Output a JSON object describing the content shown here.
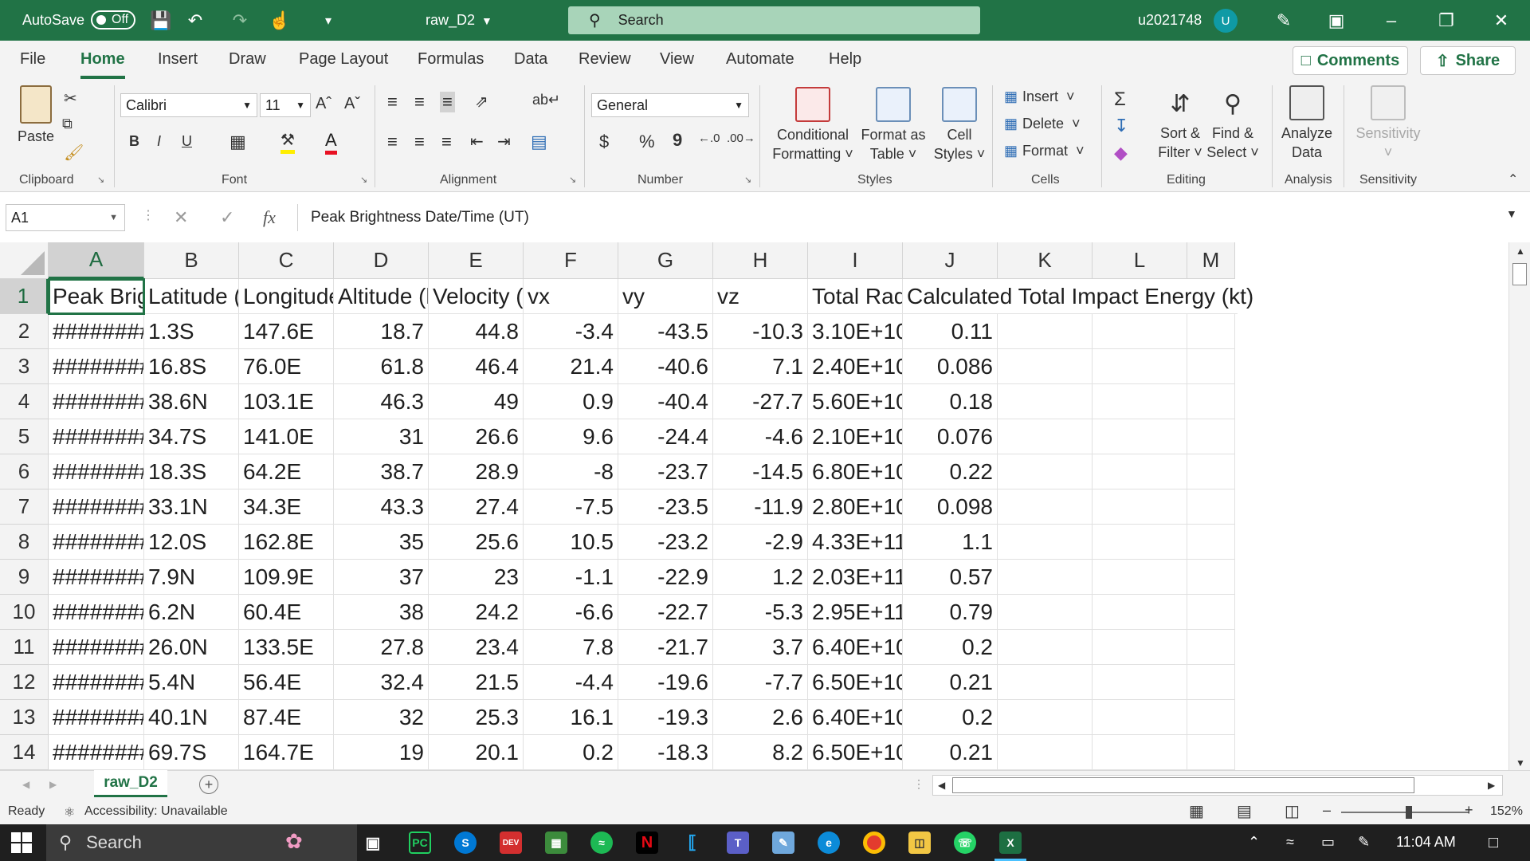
{
  "titlebar": {
    "autosave_label": "AutoSave",
    "autosave_state": "Off",
    "filename": "raw_D2",
    "search_placeholder": "Search",
    "user": "u2021748",
    "avatar_initial": "U"
  },
  "tabs": [
    "File",
    "Home",
    "Insert",
    "Draw",
    "Page Layout",
    "Formulas",
    "Data",
    "Review",
    "View",
    "Automate",
    "Help"
  ],
  "active_tab": "Home",
  "tab_actions": {
    "comments": "Comments",
    "share": "Share"
  },
  "ribbon": {
    "clipboard": {
      "paste": "Paste",
      "label": "Clipboard"
    },
    "font": {
      "name": "Calibri",
      "size": "11",
      "bold": "B",
      "italic": "I",
      "underline": "U",
      "label": "Font"
    },
    "alignment": {
      "label": "Alignment"
    },
    "number": {
      "format": "General",
      "label": "Number",
      "currency": "$",
      "percent": "%",
      "comma": "9"
    },
    "styles": {
      "conditional_line1": "Conditional",
      "conditional_line2": "Formatting",
      "format_table_line1": "Format as",
      "format_table_line2": "Table",
      "cell_styles_line1": "Cell",
      "cell_styles_line2": "Styles",
      "label": "Styles"
    },
    "cells": {
      "insert": "Insert",
      "delete": "Delete",
      "format": "Format",
      "label": "Cells"
    },
    "editing": {
      "sort_line1": "Sort &",
      "sort_line2": "Filter",
      "find_line1": "Find &",
      "find_line2": "Select",
      "label": "Editing"
    },
    "analysis": {
      "line1": "Analyze",
      "line2": "Data",
      "label": "Analysis"
    },
    "sensitivity": {
      "button": "Sensitivity",
      "label": "Sensitivity"
    }
  },
  "formula_bar": {
    "name_box": "A1",
    "fx": "fx",
    "content": "Peak Brightness Date/Time (UT)"
  },
  "columns": [
    "A",
    "B",
    "C",
    "D",
    "E",
    "F",
    "G",
    "H",
    "I",
    "J",
    "K",
    "L",
    "M"
  ],
  "selected_column": "A",
  "header_row": [
    "Peak Brigh",
    "Latitude (d",
    "Longitude",
    "Altitude (k",
    "Velocity (k",
    "vx",
    "vy",
    "vz",
    "Total Radia",
    "Calculated Total Impact Energy (kt)"
  ],
  "rows": [
    {
      "n": "2",
      "cells": [
        "########",
        "1.3S",
        "147.6E",
        "18.7",
        "44.8",
        "-3.4",
        "-43.5",
        "-10.3",
        "3.10E+10",
        "0.11"
      ]
    },
    {
      "n": "3",
      "cells": [
        "########",
        "16.8S",
        "76.0E",
        "61.8",
        "46.4",
        "21.4",
        "-40.6",
        "7.1",
        "2.40E+10",
        "0.086"
      ]
    },
    {
      "n": "4",
      "cells": [
        "########",
        "38.6N",
        "103.1E",
        "46.3",
        "49",
        "0.9",
        "-40.4",
        "-27.7",
        "5.60E+10",
        "0.18"
      ]
    },
    {
      "n": "5",
      "cells": [
        "########",
        "34.7S",
        "141.0E",
        "31",
        "26.6",
        "9.6",
        "-24.4",
        "-4.6",
        "2.10E+10",
        "0.076"
      ]
    },
    {
      "n": "6",
      "cells": [
        "########",
        "18.3S",
        "64.2E",
        "38.7",
        "28.9",
        "-8",
        "-23.7",
        "-14.5",
        "6.80E+10",
        "0.22"
      ]
    },
    {
      "n": "7",
      "cells": [
        "########",
        "33.1N",
        "34.3E",
        "43.3",
        "27.4",
        "-7.5",
        "-23.5",
        "-11.9",
        "2.80E+10",
        "0.098"
      ]
    },
    {
      "n": "8",
      "cells": [
        "########",
        "12.0S",
        "162.8E",
        "35",
        "25.6",
        "10.5",
        "-23.2",
        "-2.9",
        "4.33E+11",
        "1.1"
      ]
    },
    {
      "n": "9",
      "cells": [
        "########",
        "7.9N",
        "109.9E",
        "37",
        "23",
        "-1.1",
        "-22.9",
        "1.2",
        "2.03E+11",
        "0.57"
      ]
    },
    {
      "n": "10",
      "cells": [
        "########",
        "6.2N",
        "60.4E",
        "38",
        "24.2",
        "-6.6",
        "-22.7",
        "-5.3",
        "2.95E+11",
        "0.79"
      ]
    },
    {
      "n": "11",
      "cells": [
        "########",
        "26.0N",
        "133.5E",
        "27.8",
        "23.4",
        "7.8",
        "-21.7",
        "3.7",
        "6.40E+10",
        "0.2"
      ]
    },
    {
      "n": "12",
      "cells": [
        "########",
        "5.4N",
        "56.4E",
        "32.4",
        "21.5",
        "-4.4",
        "-19.6",
        "-7.7",
        "6.50E+10",
        "0.21"
      ]
    },
    {
      "n": "13",
      "cells": [
        "########",
        "40.1N",
        "87.4E",
        "32",
        "25.3",
        "16.1",
        "-19.3",
        "2.6",
        "6.40E+10",
        "0.2"
      ]
    },
    {
      "n": "14",
      "cells": [
        "########",
        "69.7S",
        "164.7E",
        "19",
        "20.1",
        "0.2",
        "-18.3",
        "8.2",
        "6.50E+10",
        "0.21"
      ]
    }
  ],
  "sheet": {
    "tab": "raw_D2"
  },
  "status": {
    "ready": "Ready",
    "accessibility": "Accessibility: Unavailable",
    "zoom": "152%"
  },
  "taskbar": {
    "search": "Search",
    "time": "11:04 AM"
  },
  "colors": {
    "accent": "#217346",
    "titlebar": "#217346"
  }
}
